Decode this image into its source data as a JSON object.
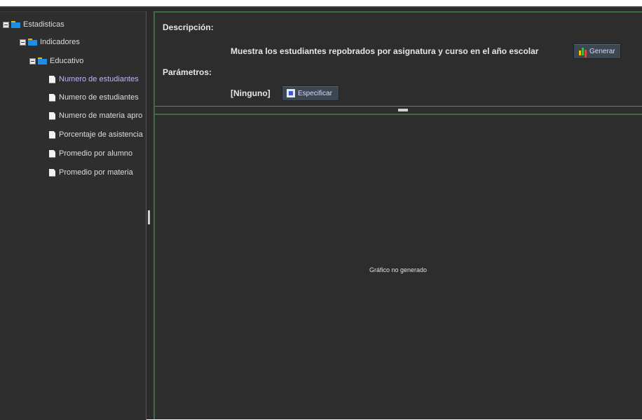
{
  "tree": {
    "root": {
      "label": "Estadisticas",
      "icon": "folder-icon"
    },
    "level1": {
      "label": "Indicadores",
      "icon": "folder-icon"
    },
    "level2": {
      "label": "Educativo",
      "icon": "folder-icon"
    },
    "reports": [
      {
        "label": "Numero de estudiantes",
        "selected": true,
        "icon": "file-icon"
      },
      {
        "label": "Numero de estudiantes",
        "selected": false,
        "icon": "file-icon"
      },
      {
        "label": "Numero de materia apro",
        "selected": false,
        "icon": "file-icon"
      },
      {
        "label": "Porcentaje de asistencia",
        "selected": false,
        "icon": "file-icon"
      },
      {
        "label": "Promedio por alumno",
        "selected": false,
        "icon": "file-icon"
      },
      {
        "label": "Promedio por materia",
        "selected": false,
        "icon": "file-icon"
      }
    ]
  },
  "detail": {
    "description_label": "Descripción:",
    "description_text": "Muestra los estudiantes repobrados por asignatura y curso en el año escolar",
    "generate_button": "Generar",
    "parameters_label": "Parámetros:",
    "parameters_value": "[Ninguno]",
    "specify_button": "Especificar",
    "chart_placeholder": "Gráfico no generado"
  },
  "colors": {
    "background": "#2b2b2b",
    "accent_border": "#3f6b4a",
    "selected_text": "#b7b7ff"
  }
}
